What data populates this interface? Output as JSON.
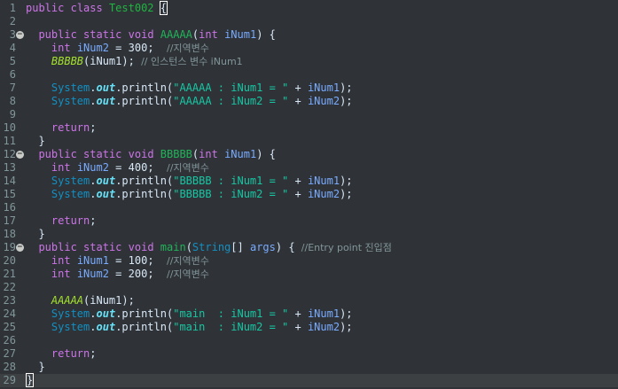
{
  "editor": {
    "colors": {
      "background": "#2f3337",
      "current_line": "#3c4043",
      "keyword": "#cd74e8",
      "string": "#17c6a3",
      "comment": "#81969a",
      "variable": "#79abff",
      "type": "#1290c3"
    },
    "current_line": 29,
    "lines": [
      {
        "n": "1",
        "fold": false,
        "tokens": [
          [
            "kw",
            "public"
          ],
          [
            "plain",
            " "
          ],
          [
            "kw",
            "class"
          ],
          [
            "plain",
            " "
          ],
          [
            "cls",
            "Test002"
          ],
          [
            "plain",
            " "
          ],
          [
            "bracket",
            "{"
          ]
        ]
      },
      {
        "n": "2",
        "fold": false,
        "tokens": []
      },
      {
        "n": "3",
        "fold": true,
        "tokens": [
          [
            "plain",
            "  "
          ],
          [
            "kw",
            "public"
          ],
          [
            "plain",
            " "
          ],
          [
            "kw",
            "static"
          ],
          [
            "plain",
            " "
          ],
          [
            "kw",
            "void"
          ],
          [
            "plain",
            " "
          ],
          [
            "meth",
            "AAAAA"
          ],
          [
            "plain",
            "("
          ],
          [
            "kw",
            "int"
          ],
          [
            "plain",
            " "
          ],
          [
            "var",
            "iNum1"
          ],
          [
            "plain",
            ") {"
          ]
        ]
      },
      {
        "n": "4",
        "fold": false,
        "tokens": [
          [
            "plain",
            "    "
          ],
          [
            "kw",
            "int"
          ],
          [
            "plain",
            " "
          ],
          [
            "var",
            "iNum2"
          ],
          [
            "plain",
            " = "
          ],
          [
            "plain",
            "300"
          ],
          [
            "plain",
            ";  "
          ],
          [
            "cmt",
            "//지역변수"
          ]
        ]
      },
      {
        "n": "5",
        "fold": false,
        "tokens": [
          [
            "plain",
            "    "
          ],
          [
            "methcall",
            "BBBBB"
          ],
          [
            "plain",
            "(iNum1); "
          ],
          [
            "cmt",
            "// 인스턴스 변수 iNum1"
          ]
        ]
      },
      {
        "n": "6",
        "fold": false,
        "tokens": []
      },
      {
        "n": "7",
        "fold": false,
        "tokens": [
          [
            "plain",
            "    "
          ],
          [
            "sys",
            "System"
          ],
          [
            "plain",
            "."
          ],
          [
            "field",
            "out"
          ],
          [
            "plain",
            ".println("
          ],
          [
            "str",
            "\"AAAAA : iNum1 = \""
          ],
          [
            "plain",
            " + "
          ],
          [
            "var",
            "iNum1"
          ],
          [
            "plain",
            ");"
          ]
        ]
      },
      {
        "n": "8",
        "fold": false,
        "tokens": [
          [
            "plain",
            "    "
          ],
          [
            "sys",
            "System"
          ],
          [
            "plain",
            "."
          ],
          [
            "field",
            "out"
          ],
          [
            "plain",
            ".println("
          ],
          [
            "str",
            "\"AAAAA : iNum2 = \""
          ],
          [
            "plain",
            " + "
          ],
          [
            "var",
            "iNum2"
          ],
          [
            "plain",
            ");"
          ]
        ]
      },
      {
        "n": "9",
        "fold": false,
        "tokens": []
      },
      {
        "n": "10",
        "fold": false,
        "tokens": [
          [
            "plain",
            "    "
          ],
          [
            "kw",
            "return"
          ],
          [
            "plain",
            ";"
          ]
        ]
      },
      {
        "n": "11",
        "fold": false,
        "tokens": [
          [
            "plain",
            "  }"
          ]
        ]
      },
      {
        "n": "12",
        "fold": true,
        "tokens": [
          [
            "plain",
            "  "
          ],
          [
            "kw",
            "public"
          ],
          [
            "plain",
            " "
          ],
          [
            "kw",
            "static"
          ],
          [
            "plain",
            " "
          ],
          [
            "kw",
            "void"
          ],
          [
            "plain",
            " "
          ],
          [
            "meth",
            "BBBBB"
          ],
          [
            "plain",
            "("
          ],
          [
            "kw",
            "int"
          ],
          [
            "plain",
            " "
          ],
          [
            "var",
            "iNum1"
          ],
          [
            "plain",
            ") {"
          ]
        ]
      },
      {
        "n": "13",
        "fold": false,
        "tokens": [
          [
            "plain",
            "    "
          ],
          [
            "kw",
            "int"
          ],
          [
            "plain",
            " "
          ],
          [
            "var",
            "iNum2"
          ],
          [
            "plain",
            " = "
          ],
          [
            "plain",
            "400"
          ],
          [
            "plain",
            ";  "
          ],
          [
            "cmt",
            "//지역변수"
          ]
        ]
      },
      {
        "n": "14",
        "fold": false,
        "tokens": [
          [
            "plain",
            "    "
          ],
          [
            "sys",
            "System"
          ],
          [
            "plain",
            "."
          ],
          [
            "field",
            "out"
          ],
          [
            "plain",
            ".println("
          ],
          [
            "str",
            "\"BBBBB : iNum1 = \""
          ],
          [
            "plain",
            " + "
          ],
          [
            "var",
            "iNum1"
          ],
          [
            "plain",
            ");"
          ]
        ]
      },
      {
        "n": "15",
        "fold": false,
        "tokens": [
          [
            "plain",
            "    "
          ],
          [
            "sys",
            "System"
          ],
          [
            "plain",
            "."
          ],
          [
            "field",
            "out"
          ],
          [
            "plain",
            ".println("
          ],
          [
            "str",
            "\"BBBBB : iNum2 = \""
          ],
          [
            "plain",
            " + "
          ],
          [
            "var",
            "iNum2"
          ],
          [
            "plain",
            ");"
          ]
        ]
      },
      {
        "n": "16",
        "fold": false,
        "tokens": []
      },
      {
        "n": "17",
        "fold": false,
        "tokens": [
          [
            "plain",
            "    "
          ],
          [
            "kw",
            "return"
          ],
          [
            "plain",
            ";"
          ]
        ]
      },
      {
        "n": "18",
        "fold": false,
        "tokens": [
          [
            "plain",
            "  }"
          ]
        ]
      },
      {
        "n": "19",
        "fold": true,
        "tokens": [
          [
            "plain",
            "  "
          ],
          [
            "kw",
            "public"
          ],
          [
            "plain",
            " "
          ],
          [
            "kw",
            "static"
          ],
          [
            "plain",
            " "
          ],
          [
            "kw",
            "void"
          ],
          [
            "plain",
            " "
          ],
          [
            "meth",
            "main"
          ],
          [
            "plain",
            "("
          ],
          [
            "type",
            "String"
          ],
          [
            "plain",
            "[] "
          ],
          [
            "var",
            "args"
          ],
          [
            "plain",
            ") { "
          ],
          [
            "cmt",
            "//Entry point 진입점"
          ]
        ]
      },
      {
        "n": "20",
        "fold": false,
        "tokens": [
          [
            "plain",
            "    "
          ],
          [
            "kw",
            "int"
          ],
          [
            "plain",
            " "
          ],
          [
            "var",
            "iNum1"
          ],
          [
            "plain",
            " = "
          ],
          [
            "plain",
            "100"
          ],
          [
            "plain",
            ";  "
          ],
          [
            "cmt",
            "//지역변수"
          ]
        ]
      },
      {
        "n": "21",
        "fold": false,
        "tokens": [
          [
            "plain",
            "    "
          ],
          [
            "kw",
            "int"
          ],
          [
            "plain",
            " "
          ],
          [
            "var",
            "iNum2"
          ],
          [
            "plain",
            " = "
          ],
          [
            "plain",
            "200"
          ],
          [
            "plain",
            ";  "
          ],
          [
            "cmt",
            "//지역변수"
          ]
        ]
      },
      {
        "n": "22",
        "fold": false,
        "tokens": []
      },
      {
        "n": "23",
        "fold": false,
        "tokens": [
          [
            "plain",
            "    "
          ],
          [
            "methcall",
            "AAAAA"
          ],
          [
            "plain",
            "(iNum1);"
          ]
        ]
      },
      {
        "n": "24",
        "fold": false,
        "tokens": [
          [
            "plain",
            "    "
          ],
          [
            "sys",
            "System"
          ],
          [
            "plain",
            "."
          ],
          [
            "field",
            "out"
          ],
          [
            "plain",
            ".println("
          ],
          [
            "str",
            "\"main  : iNum1 = \""
          ],
          [
            "plain",
            " + "
          ],
          [
            "var",
            "iNum1"
          ],
          [
            "plain",
            ");"
          ]
        ]
      },
      {
        "n": "25",
        "fold": false,
        "tokens": [
          [
            "plain",
            "    "
          ],
          [
            "sys",
            "System"
          ],
          [
            "plain",
            "."
          ],
          [
            "field",
            "out"
          ],
          [
            "plain",
            ".println("
          ],
          [
            "str",
            "\"main  : iNum2 = \""
          ],
          [
            "plain",
            " + "
          ],
          [
            "var",
            "iNum2"
          ],
          [
            "plain",
            ");"
          ]
        ]
      },
      {
        "n": "26",
        "fold": false,
        "tokens": []
      },
      {
        "n": "27",
        "fold": false,
        "tokens": [
          [
            "plain",
            "    "
          ],
          [
            "kw",
            "return"
          ],
          [
            "plain",
            ";"
          ]
        ]
      },
      {
        "n": "28",
        "fold": false,
        "tokens": [
          [
            "plain",
            "  }"
          ]
        ]
      },
      {
        "n": "29",
        "fold": false,
        "tokens": [
          [
            "caret",
            ""
          ],
          [
            "bracket",
            "}"
          ]
        ]
      }
    ]
  }
}
